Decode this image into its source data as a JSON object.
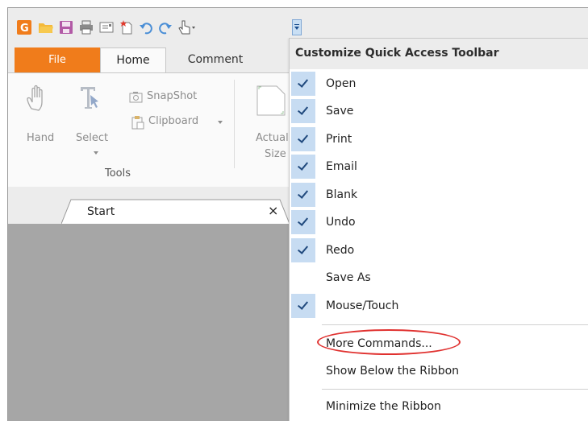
{
  "tabs": {
    "file": "File",
    "home": "Home",
    "comment": "Comment"
  },
  "ribbon": {
    "hand": "Hand",
    "select": "Select",
    "snapshot": "SnapShot",
    "clipboard": "Clipboard",
    "actual1": "Actual",
    "actual2": "Size",
    "group_tools": "Tools"
  },
  "doc_tab": {
    "label": "Start",
    "close": "×"
  },
  "menu": {
    "title": "Customize Quick Access Toolbar",
    "items": [
      {
        "label": "Open",
        "checked": true
      },
      {
        "label": "Save",
        "checked": true
      },
      {
        "label": "Print",
        "checked": true
      },
      {
        "label": "Email",
        "checked": true
      },
      {
        "label": "Blank",
        "checked": true
      },
      {
        "label": "Undo",
        "checked": true
      },
      {
        "label": "Redo",
        "checked": true
      },
      {
        "label": "Save As",
        "checked": false
      },
      {
        "label": "Mouse/Touch",
        "checked": true
      }
    ],
    "more_commands": "More Commands...",
    "show_below": "Show Below the Ribbon",
    "minimize": "Minimize the Ribbon"
  },
  "colors": {
    "file_tab": "#f07c1b",
    "check_bg": "#c7dcf2",
    "highlight_oval": "#e0312f"
  }
}
